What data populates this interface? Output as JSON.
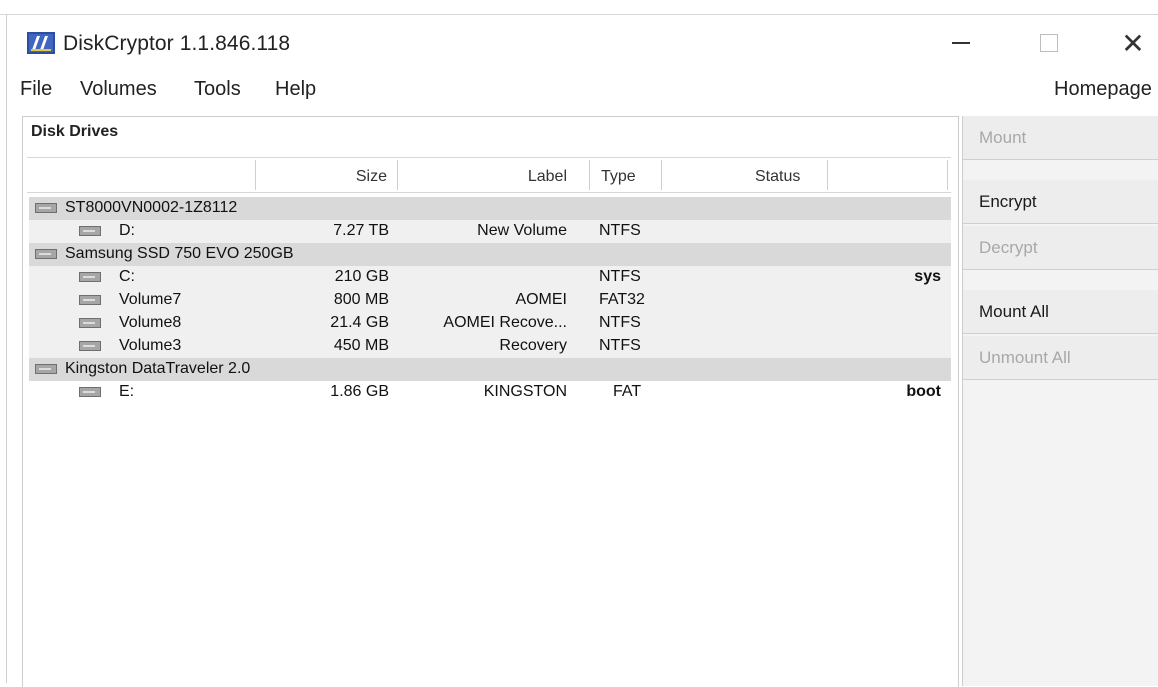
{
  "window": {
    "title": "DiskCryptor 1.1.846.118",
    "controls": {
      "minimize": "—",
      "close": "✕"
    }
  },
  "menu": {
    "items": [
      "File",
      "Volumes",
      "Tools",
      "Help"
    ],
    "homepage": "Homepage"
  },
  "left_panel": {
    "title": "Disk Drives",
    "columns": [
      "Size",
      "Label",
      "Type",
      "Status"
    ],
    "rows": [
      {
        "kind": "disk",
        "name": "ST8000VN0002-1Z8112"
      },
      {
        "kind": "vol",
        "name": "D:",
        "size": "7.27 TB",
        "label": "New Volume",
        "type": "NTFS",
        "flag": ""
      },
      {
        "kind": "disk",
        "name": "Samsung SSD 750 EVO 250GB"
      },
      {
        "kind": "vol",
        "name": "C:",
        "size": "210 GB",
        "label": "",
        "type": "NTFS",
        "flag": "sys"
      },
      {
        "kind": "vol",
        "name": "Volume7",
        "size": "800 MB",
        "label": "AOMEI",
        "type": "FAT32",
        "flag": ""
      },
      {
        "kind": "vol",
        "name": "Volume8",
        "size": "21.4 GB",
        "label": "AOMEI Recove...",
        "type": "NTFS",
        "flag": ""
      },
      {
        "kind": "vol",
        "name": "Volume3",
        "size": "450 MB",
        "label": "Recovery",
        "type": "NTFS",
        "flag": ""
      },
      {
        "kind": "disk",
        "name": "Kingston DataTraveler 2.0"
      },
      {
        "kind": "vol",
        "name": "E:",
        "size": "1.86 GB",
        "label": "KINGSTON",
        "type": "FAT",
        "flag": "boot"
      }
    ]
  },
  "right_panel": {
    "buttons": [
      {
        "label": "Mount",
        "enabled": false
      },
      {
        "label": "Encrypt",
        "enabled": true
      },
      {
        "label": "Decrypt",
        "enabled": false
      },
      {
        "label": "Mount All",
        "enabled": true
      },
      {
        "label": "Unmount All",
        "enabled": false
      }
    ]
  }
}
